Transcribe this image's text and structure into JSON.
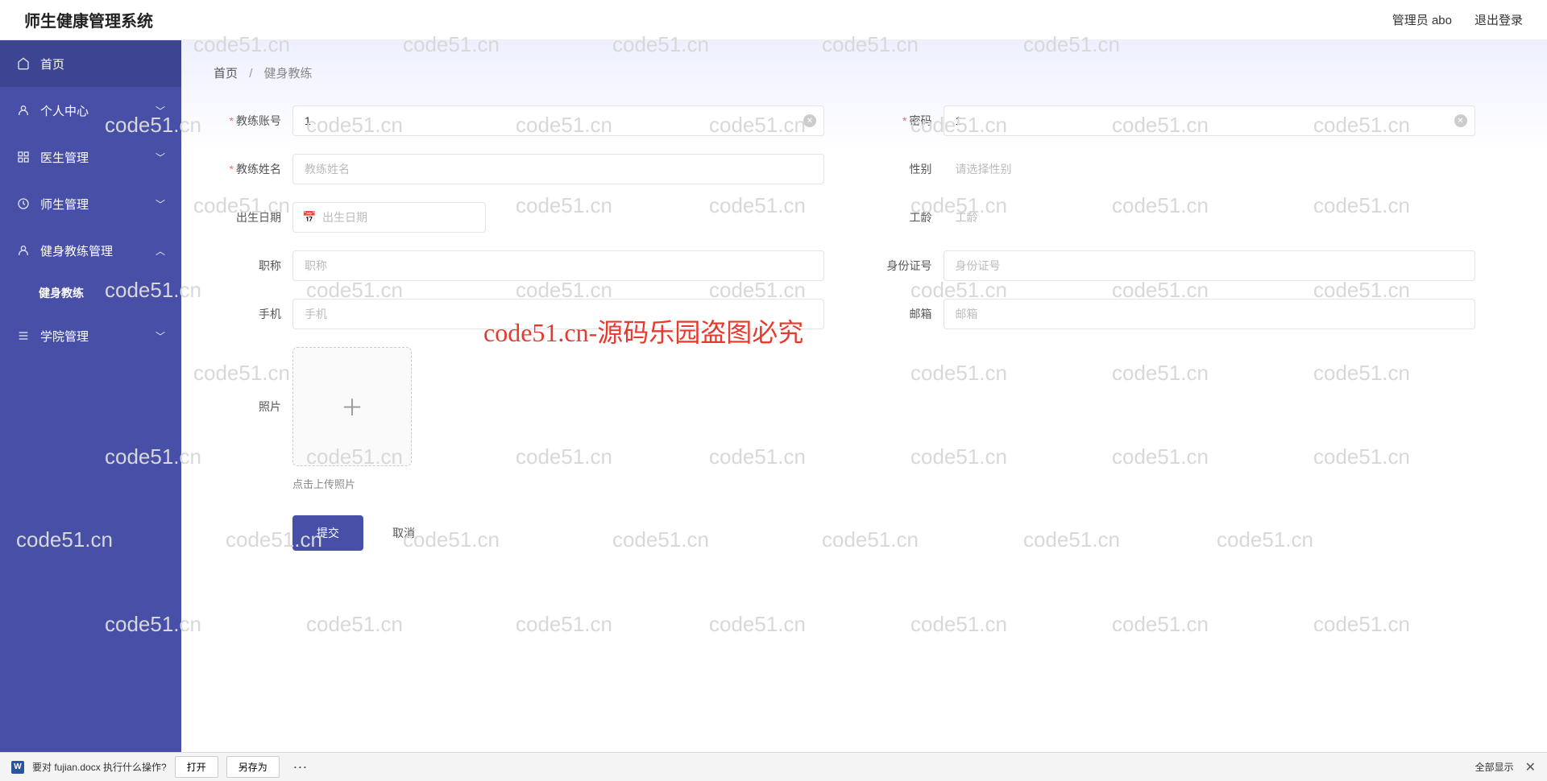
{
  "app": {
    "title": "师生健康管理系统"
  },
  "header": {
    "admin_label": "管理员 abo",
    "logout_label": "退出登录"
  },
  "sidebar": {
    "items": [
      {
        "label": "首页",
        "icon": "home",
        "expandable": false
      },
      {
        "label": "个人中心",
        "icon": "user",
        "expandable": true,
        "expanded": false
      },
      {
        "label": "医生管理",
        "icon": "grid",
        "expandable": true,
        "expanded": false
      },
      {
        "label": "师生管理",
        "icon": "clock",
        "expandable": true,
        "expanded": false
      },
      {
        "label": "健身教练管理",
        "icon": "user",
        "expandable": true,
        "expanded": true
      },
      {
        "label": "学院管理",
        "icon": "list",
        "expandable": true,
        "expanded": false
      }
    ],
    "submenu_coach": {
      "label": "健身教练"
    }
  },
  "breadcrumb": {
    "home": "首页",
    "current": "健身教练"
  },
  "form": {
    "account": {
      "label": "教练账号",
      "value": "1",
      "required": true
    },
    "password": {
      "label": "密码",
      "value": "1",
      "required": true
    },
    "name": {
      "label": "教练姓名",
      "placeholder": "教练姓名",
      "value": "",
      "required": true
    },
    "gender": {
      "label": "性别",
      "placeholder": "请选择性别",
      "value": ""
    },
    "birth": {
      "label": "出生日期",
      "placeholder": "出生日期",
      "value": ""
    },
    "workage": {
      "label": "工龄",
      "placeholder": "工龄",
      "value": ""
    },
    "title": {
      "label": "职称",
      "placeholder": "职称",
      "value": ""
    },
    "idcard": {
      "label": "身份证号",
      "placeholder": "身份证号",
      "value": ""
    },
    "phone": {
      "label": "手机",
      "placeholder": "手机",
      "value": ""
    },
    "email": {
      "label": "邮箱",
      "placeholder": "邮箱",
      "value": ""
    },
    "photo": {
      "label": "照片",
      "hint": "点击上传照片"
    },
    "submit": "提交",
    "cancel": "取消"
  },
  "bottombar": {
    "prompt": "要对 fujian.docx 执行什么操作?",
    "open": "打开",
    "saveas": "另存为",
    "showall": "全部显示"
  },
  "watermark": {
    "text": "code51.cn",
    "red": "code51.cn-源码乐园盗图必究"
  }
}
